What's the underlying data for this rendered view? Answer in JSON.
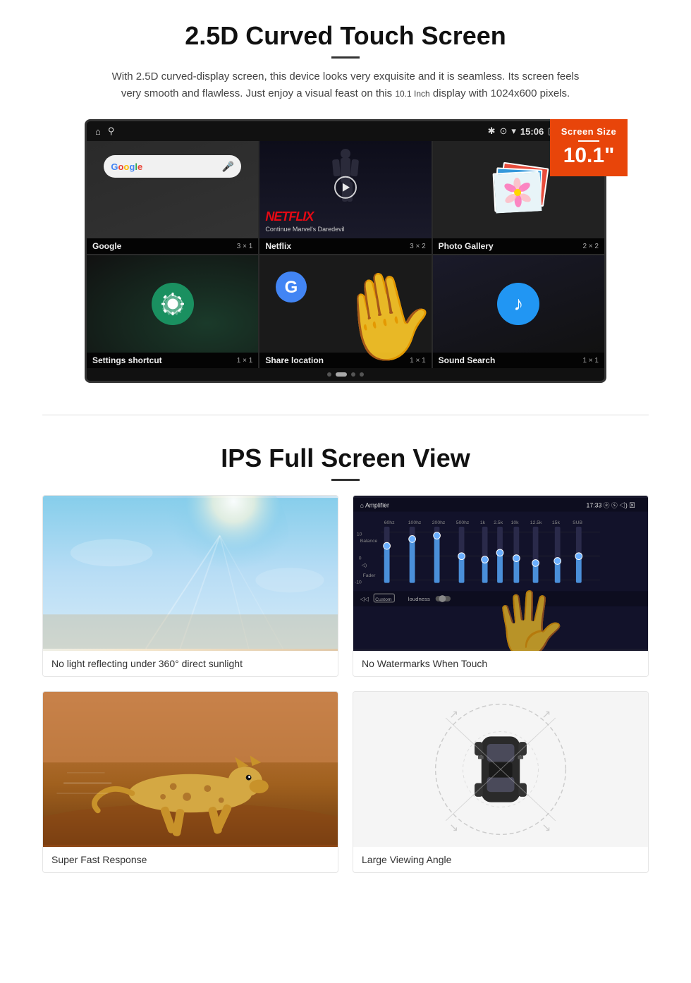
{
  "section1": {
    "title": "2.5D Curved Touch Screen",
    "description_part1": "With 2.5D curved-display screen, this device looks very exquisite and it is seamless. Its screen feels very smooth and flawless. Just enjoy a visual feast on this",
    "description_small": "10.1 Inch",
    "description_part2": "display with 1024x600 pixels.",
    "screen_size_badge_label": "Screen Size",
    "screen_size_badge_size": "10.1\""
  },
  "status_bar": {
    "time": "15:06"
  },
  "app_grid": {
    "cells": [
      {
        "name": "Google",
        "size": "3 × 1"
      },
      {
        "name": "Netflix",
        "size": "3 × 2"
      },
      {
        "name": "Photo Gallery",
        "size": "2 × 2"
      },
      {
        "name": "Settings shortcut",
        "size": "1 × 1"
      },
      {
        "name": "Share location",
        "size": "1 × 1"
      },
      {
        "name": "Sound Search",
        "size": "1 × 1"
      }
    ],
    "netflix_text": "NETFLIX",
    "netflix_subtitle": "Continue Marvel's Daredevil"
  },
  "section2": {
    "title": "IPS Full Screen View",
    "features": [
      {
        "id": "sunlight",
        "caption": "No light reflecting under 360° direct sunlight"
      },
      {
        "id": "amplifier",
        "caption": "No Watermarks When Touch"
      },
      {
        "id": "cheetah",
        "caption": "Super Fast Response"
      },
      {
        "id": "car",
        "caption": "Large Viewing Angle"
      }
    ]
  },
  "amp": {
    "title": "Amplifier",
    "time": "17:33",
    "custom_label": "Custom",
    "loudness_label": "loudness",
    "freq_labels": [
      "60hz",
      "100hz",
      "200hz",
      "500hz",
      "1k",
      "2.5k",
      "10k",
      "12.5k",
      "15k",
      "SUB"
    ],
    "balance_label": "Balance",
    "fader_label": "Fader"
  }
}
